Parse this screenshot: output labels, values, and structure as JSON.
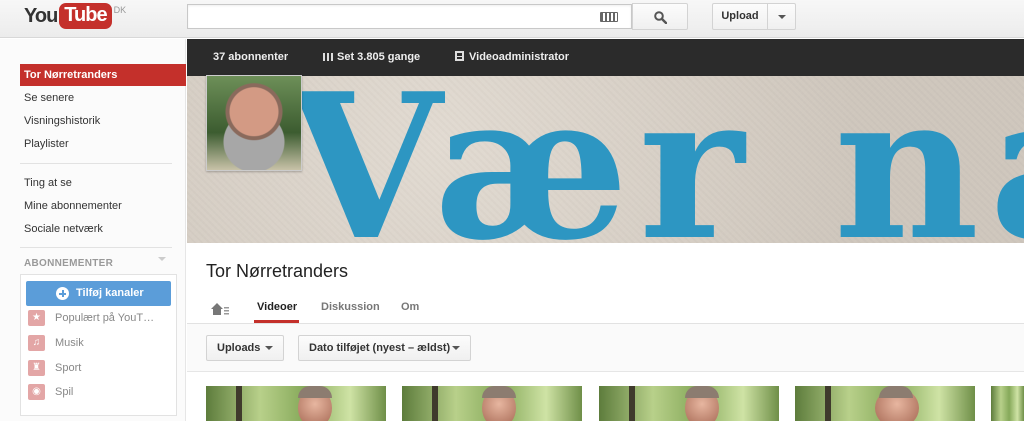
{
  "masthead": {
    "logo_you": "You",
    "logo_tube": "Tube",
    "logo_country": "DK",
    "search": {
      "placeholder": "",
      "value": "",
      "keyboard_icon": "keyboard-icon",
      "button_icon": "search-icon"
    },
    "upload_label": "Upload",
    "upload_menu_icon": "chevron-down-icon"
  },
  "sidebar": {
    "top_items": [
      {
        "label": "Tor Nørretranders",
        "active": true
      },
      {
        "label": "Se senere"
      },
      {
        "label": "Visningshistorik"
      },
      {
        "label": "Playlister"
      }
    ],
    "mid_items": [
      {
        "label": "Ting at se"
      },
      {
        "label": "Mine abonnementer"
      },
      {
        "label": "Sociale netværk"
      }
    ],
    "subscriptions_heading": "ABONNEMENTER",
    "add_channels_label": "Tilføj kanaler",
    "subscriptions": [
      {
        "label": "Populært på YouT…",
        "icon": "star-icon"
      },
      {
        "label": "Musik",
        "icon": "headphones-icon"
      },
      {
        "label": "Sport",
        "icon": "trophy-icon"
      },
      {
        "label": "Spil",
        "icon": "gamepad-icon"
      }
    ]
  },
  "channel": {
    "stats": {
      "subscribers": "37 abonnenter",
      "views": "Set 3.805 gange",
      "video_manager": "Videoadministrator"
    },
    "banner_text": "Vær næ",
    "title": "Tor Nørretranders",
    "tabs": [
      "Videoer",
      "Diskussion",
      "Om"
    ],
    "active_tab": "Videoer",
    "filters": {
      "uploads": "Uploads",
      "sort": "Dato tilføjet (nyest – ældst)"
    }
  },
  "colors": {
    "brand_red": "#c4302b",
    "button_blue": "#5b9dd9",
    "stats_bar": "#2b2b2b",
    "banner_text": "#2d96c2"
  }
}
